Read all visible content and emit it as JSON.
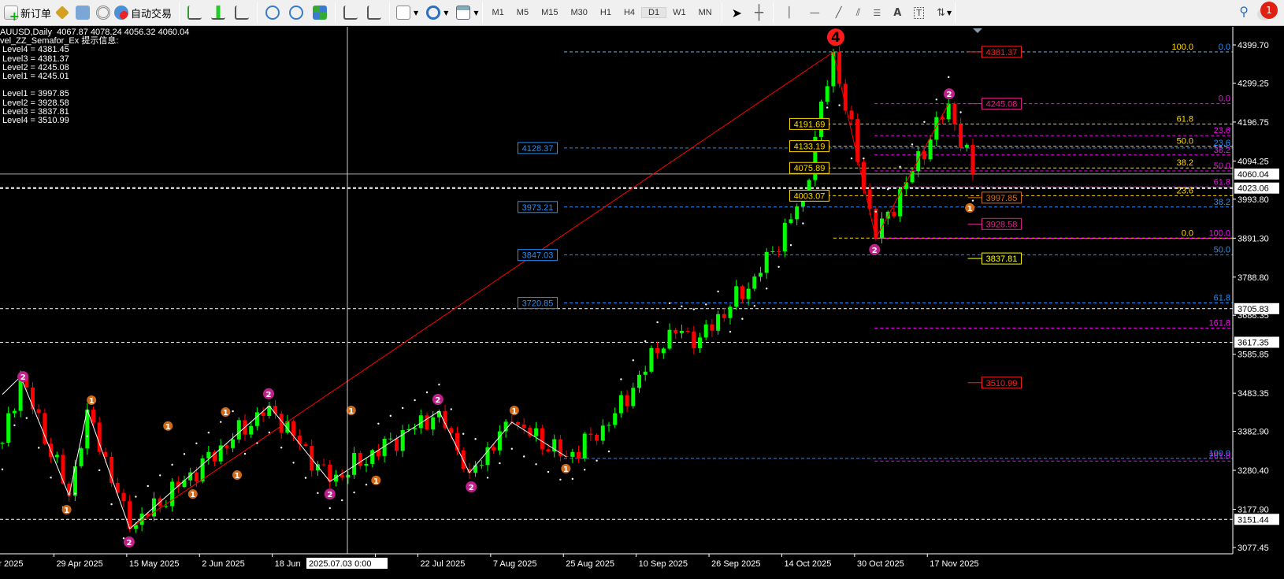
{
  "toolbar": {
    "new_order": "新订单",
    "auto_trading": "自动交易",
    "timeframes": [
      "M1",
      "M5",
      "M15",
      "M30",
      "H1",
      "H4",
      "D1",
      "W1",
      "MN"
    ],
    "active_timeframe": "D1",
    "notification_count": "1"
  },
  "info": {
    "header": "AUUSD,Daily  4067.87 4078.24 4056.32 4060.04",
    "indicator": "vel_ZZ_Semafor_Ex 提示信息:",
    "upper": [
      "Level4 = 4381.45",
      "Level3 = 4381.37",
      "Level2 = 4245.08",
      "Level1 = 4245.01"
    ],
    "lower": [
      "Level1 = 3997.85",
      "Level2 = 3928.58",
      "Level3 = 3837.81",
      "Level4 = 3510.99"
    ]
  },
  "price_axis": {
    "ticks": [
      "4399.70",
      "4299.25",
      "4196.75",
      "4094.25",
      "3993.80",
      "3891.30",
      "3788.80",
      "3688.35",
      "3585.85",
      "3483.35",
      "3382.90",
      "3280.40",
      "3177.90",
      "3077.45"
    ],
    "tick_values": [
      4399.7,
      4299.25,
      4196.75,
      4094.25,
      3993.8,
      3891.3,
      3788.8,
      3688.35,
      3585.85,
      3483.35,
      3382.9,
      3280.4,
      3177.9,
      3077.45
    ],
    "boxes": [
      {
        "label": "4060.04",
        "value": 4060.04
      },
      {
        "label": "4023.06",
        "value": 4023.06
      },
      {
        "label": "3705.83",
        "value": 3705.83
      },
      {
        "label": "3617.35",
        "value": 3617.35
      },
      {
        "label": "3151.44",
        "value": 3151.44
      }
    ]
  },
  "time_axis": {
    "labels": [
      "r 2025",
      "29 Apr 2025",
      "15 May 2025",
      "2 Jun 2025",
      "18 Jun",
      "25",
      "22 Jul 2025",
      "7 Aug 2025",
      "25 Aug 2025",
      "10 Sep 2025",
      "26 Sep 2025",
      "14 Oct 2025",
      "30 Oct 2025",
      "17 Nov 2025"
    ],
    "label_bars": [
      -1,
      8.5,
      20.5,
      32.5,
      44.5,
      61.5,
      68.5,
      80.5,
      92.5,
      104.5,
      116.5,
      128.5,
      140.5,
      152.5
    ],
    "crosshair_label": "2025.07.03 0:00"
  },
  "chart_data": {
    "type": "candlestick",
    "symbol": "AUUSD",
    "timeframe": "Daily",
    "ylim": [
      3050,
      4420
    ],
    "bars": 161,
    "pivots": [
      [
        0,
        3353
      ],
      [
        3,
        3527
      ],
      [
        11,
        3214
      ],
      [
        14,
        3440
      ],
      [
        21,
        3127
      ],
      [
        44,
        3450
      ],
      [
        54,
        3251
      ],
      [
        72,
        3436
      ],
      [
        77,
        3274
      ],
      [
        84,
        3407
      ],
      [
        93,
        3316
      ],
      [
        100,
        3400
      ],
      [
        110,
        3650
      ],
      [
        115,
        3630
      ],
      [
        125,
        3800
      ],
      [
        132,
        4000
      ],
      [
        137,
        4381
      ],
      [
        144,
        3891
      ],
      [
        156,
        4245
      ],
      [
        160,
        4060
      ]
    ],
    "zigzag_red": [
      [
        21,
        3127
      ],
      [
        137,
        4381
      ],
      [
        144,
        3891
      ],
      [
        156,
        4245
      ]
    ],
    "zigzag_white": [
      [
        0,
        3480
      ],
      [
        3,
        3527
      ],
      [
        11,
        3214
      ],
      [
        14,
        3440
      ],
      [
        21,
        3127
      ],
      [
        44,
        3450
      ],
      [
        54,
        3251
      ],
      [
        72,
        3436
      ],
      [
        77,
        3274
      ],
      [
        84,
        3407
      ],
      [
        93,
        3316
      ]
    ],
    "semafor": [
      {
        "bar": 137.4,
        "price": 4420,
        "level": "4"
      },
      {
        "bar": 3.4,
        "price": 3527,
        "level": "2"
      },
      {
        "bar": 20.9,
        "price": 3092,
        "level": "2"
      },
      {
        "bar": 43.9,
        "price": 3482,
        "level": "2"
      },
      {
        "bar": 54,
        "price": 3218,
        "level": "2"
      },
      {
        "bar": 71.8,
        "price": 3467,
        "level": "2"
      },
      {
        "bar": 77.3,
        "price": 3237,
        "level": "2"
      },
      {
        "bar": 143.8,
        "price": 3861,
        "level": "2"
      },
      {
        "bar": 156.1,
        "price": 4271,
        "level": "2"
      },
      {
        "bar": 10.6,
        "price": 3177,
        "level": "1"
      },
      {
        "bar": 14.7,
        "price": 3465,
        "level": "1"
      },
      {
        "bar": 27.3,
        "price": 3397,
        "level": "1"
      },
      {
        "bar": 31.4,
        "price": 3218,
        "level": "1"
      },
      {
        "bar": 36.8,
        "price": 3434,
        "level": "1"
      },
      {
        "bar": 38.7,
        "price": 3268,
        "level": "1"
      },
      {
        "bar": 57.5,
        "price": 3438,
        "level": "1"
      },
      {
        "bar": 61.6,
        "price": 3254,
        "level": "1"
      },
      {
        "bar": 84.4,
        "price": 3438,
        "level": "1"
      },
      {
        "bar": 92.9,
        "price": 3285,
        "level": "1"
      },
      {
        "bar": 159.5,
        "price": 3971,
        "level": "1"
      }
    ],
    "fib_levels": [
      {
        "label": "100.0",
        "value": 4381.37,
        "color": "#ffd700",
        "from_bar": 92.6,
        "label_pos": "left"
      },
      {
        "label": "0.0",
        "value": 4381.37,
        "color": "#1e90ff",
        "from_bar": 92.6,
        "label_pos": "right"
      },
      {
        "label": "0.0",
        "value": 4245.08,
        "color": "#ff00ff",
        "from_bar": 143.8,
        "label_pos": "right"
      },
      {
        "label": "61.8",
        "value": 4191.69,
        "color": "#ffd700",
        "from_bar": 136,
        "label_pos": "left"
      },
      {
        "label": "23.6",
        "value": 4161,
        "color": "#ff00ff",
        "from_bar": 143.8,
        "label_pos": "right"
      },
      {
        "label": "50.0",
        "value": 4133.19,
        "color": "#ffd700",
        "from_bar": 136,
        "label_pos": "left"
      },
      {
        "label": "23.6",
        "value": 4128.37,
        "color": "#1e90ff",
        "from_bar": 92.6,
        "label_pos": "right"
      },
      {
        "label": "38.2",
        "value": 4110,
        "color": "#ff00ff",
        "from_bar": 143.8,
        "label_pos": "right"
      },
      {
        "label": "38.2",
        "value": 4075.89,
        "color": "#ffd700",
        "from_bar": 136,
        "label_pos": "left"
      },
      {
        "label": "50.0",
        "value": 4068,
        "color": "#ff00ff",
        "from_bar": 143.8,
        "label_pos": "right"
      },
      {
        "label": "61.8",
        "value": 4026,
        "color": "#ff00ff",
        "from_bar": 143.8,
        "label_pos": "right"
      },
      {
        "label": "23.6",
        "value": 4003.07,
        "color": "#ffd700",
        "from_bar": 136,
        "label_pos": "left"
      },
      {
        "label": "38.2",
        "value": 3973.21,
        "color": "#1e90ff",
        "from_bar": 92.6,
        "label_pos": "right"
      },
      {
        "label": "0.0",
        "value": 3891.3,
        "color": "#ffd700",
        "from_bar": 137,
        "label_pos": "left"
      },
      {
        "label": "100.0",
        "value": 3891,
        "color": "#ff00ff",
        "from_bar": 143.8,
        "label_pos": "right"
      },
      {
        "label": "50.0",
        "value": 3847.03,
        "color": "#1e90ff",
        "from_bar": 92.6,
        "label_pos": "right"
      },
      {
        "label": "61.8",
        "value": 3720.85,
        "color": "#1e90ff",
        "from_bar": 92.6,
        "label_pos": "right"
      },
      {
        "label": "161.8",
        "value": 3655,
        "color": "#ff00ff",
        "from_bar": 143.8,
        "label_pos": "right"
      },
      {
        "label": "100.0",
        "value": 3312,
        "color": "#1e90ff",
        "from_bar": 92.6,
        "label_pos": "right"
      },
      {
        "label": "261.8",
        "value": 3305,
        "color": "#ff00ff",
        "from_bar": 143.8,
        "label_pos": "right"
      }
    ],
    "price_boxes": [
      {
        "label": "4128.37",
        "value": 4128.37,
        "color": "#1e90ff",
        "at_bar": 85
      },
      {
        "label": "3973.21",
        "value": 3973.21,
        "color": "#1e90ff",
        "at_bar": 85
      },
      {
        "label": "3847.03",
        "value": 3847.03,
        "color": "#1e90ff",
        "at_bar": 85
      },
      {
        "label": "3720.85",
        "value": 3720.85,
        "color": "#1e90ff",
        "at_bar": 85
      },
      {
        "label": "4191.69",
        "value": 4191.69,
        "color": "#ffd700",
        "at_bar": 129.8
      },
      {
        "label": "4133.19",
        "value": 4133.19,
        "color": "#ffd700",
        "at_bar": 129.8
      },
      {
        "label": "4075.89",
        "value": 4075.89,
        "color": "#ffd700",
        "at_bar": 129.8
      },
      {
        "label": "4003.07",
        "value": 4003.07,
        "color": "#ffd700",
        "at_bar": 129.8
      },
      {
        "label": "4381.37",
        "value": 4381.37,
        "color": "#ff2020",
        "at_bar": 161.5
      },
      {
        "label": "4245.08",
        "value": 4245.08,
        "color": "#e0208a",
        "at_bar": 161.5
      },
      {
        "label": "3997.85",
        "value": 3997.85,
        "color": "#d07020",
        "at_bar": 161.5
      },
      {
        "label": "3928.58",
        "value": 3928.58,
        "color": "#e0208a",
        "at_bar": 161.5
      },
      {
        "label": "3837.81",
        "value": 3837.81,
        "color": "#ffff00",
        "at_bar": 161.5
      },
      {
        "label": "3510.99",
        "value": 3510.99,
        "color": "#ff2020",
        "at_bar": 161.5
      }
    ],
    "colors": {
      "up": "#00ff00",
      "down": "#ff0000"
    }
  }
}
